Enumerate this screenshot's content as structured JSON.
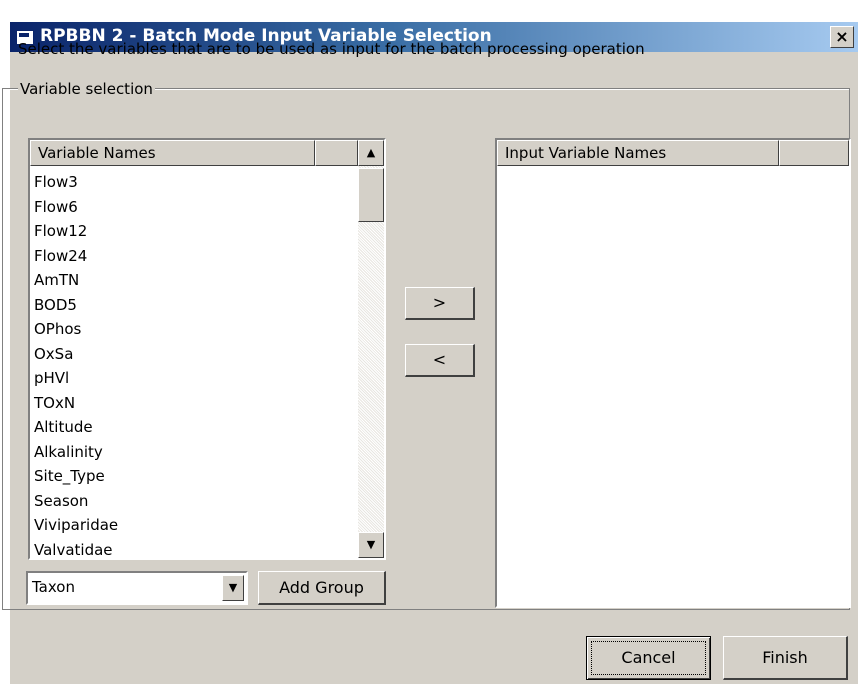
{
  "window": {
    "title": "RPBBN 2 - Batch Mode Input Variable Selection",
    "close_label": "×"
  },
  "instruction": "Select the variables that are to be used as input for the batch processing operation",
  "group_label": "Variable selection",
  "left_list": {
    "header": "Variable Names",
    "items": [
      "Flow3",
      "Flow6",
      "Flow12",
      "Flow24",
      "AmTN",
      "BOD5",
      "OPhos",
      "OxSa",
      "pHVl",
      "TOxN",
      "Altitude",
      "Alkalinity",
      "Site_Type",
      "Season",
      "Viviparidae",
      "Valvatidae"
    ]
  },
  "right_list": {
    "header": "Input Variable Names"
  },
  "add_button": ">",
  "remove_button": "<",
  "group_combo": {
    "value": "Taxon"
  },
  "add_group_button": "Add Group",
  "cancel_button": "Cancel",
  "finish_button": "Finish",
  "icons": {
    "scroll_up": "▲",
    "scroll_down": "▼",
    "combo_arrow": "▼"
  }
}
